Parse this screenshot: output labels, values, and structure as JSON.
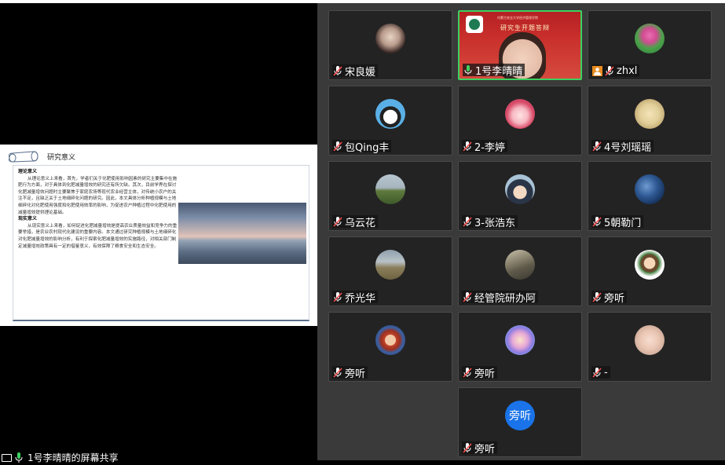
{
  "share": {
    "label": "1号李晴晴的屏幕共享",
    "slide": {
      "title": "研究意义",
      "theory_heading": "理论意义",
      "theory_text": "从理论意义上来看，首先，学者们关于化肥使用影响因素的研究主要集中在施肥行为方面，对于具体到化肥减量增效的研究还有所欠缺。其次，目前学界在探讨化肥减量增效问题时主要聚焦于家庭农场等现代农业经营主体，对传统小农户的关注不足，且缺乏关于土地细碎化问题的研究。因此，本文具体分析种植规模与土地细碎化对化肥使用强度和化肥使用效率的影响，为促进农户种植过程中化肥使用的减量增效提供理论基础。",
      "practical_heading": "现实意义",
      "practical_text": "从现实意义上来看，如何促进化肥减量增效是提高农业质量效益和竞争力的重要举措，是农业农村现代化建设的重要内容。本文通过研究种植规模与土地细碎化对化肥减量增效的影响分析，有利于探索化肥减量增效的实施路径，对相关部门制定减量增效政策具有一定的借鉴意义，有效保障了粮食安全和生态安全。"
    }
  },
  "active_video": {
    "banner_small": "内蒙古农业大学经济管理学院",
    "banner_large": "研究生开题答辩"
  },
  "participants": [
    {
      "name": "宋良媛",
      "avatar": "photo-avatar"
    },
    {
      "name": "1号李晴晴",
      "avatar": "video",
      "active": true
    },
    {
      "name": "zhxl",
      "avatar": "flower-avatar",
      "host": true
    },
    {
      "name": "包Qing丰",
      "avatar": "cartoon-avatar"
    },
    {
      "name": "2-李婷",
      "avatar": "cartoon-avatar"
    },
    {
      "name": "4号刘瑶瑶",
      "avatar": "photo-avatar"
    },
    {
      "name": "乌云花",
      "avatar": "landscape-avatar"
    },
    {
      "name": "3-张浩东",
      "avatar": "anime-avatar"
    },
    {
      "name": "5朝勒门",
      "avatar": "ocean-avatar"
    },
    {
      "name": "乔光华",
      "avatar": "landscape-avatar"
    },
    {
      "name": "经管院研办阿",
      "avatar": "building-avatar"
    },
    {
      "name": "旁听",
      "avatar": "cartoon-avatar"
    },
    {
      "name": "旁听",
      "avatar": "anime-avatar"
    },
    {
      "name": "旁听",
      "avatar": "cartoon-avatar"
    },
    {
      "name": "-",
      "avatar": "baby-avatar"
    },
    {
      "name": "旁听",
      "avatar": "text-avatar",
      "initials": "旁听"
    }
  ],
  "colors": {
    "active_border": "#3cd160",
    "muted_mic": "#ff4d4f",
    "text_avatar": "#1a73e8",
    "host_badge": "#e98c1f"
  }
}
